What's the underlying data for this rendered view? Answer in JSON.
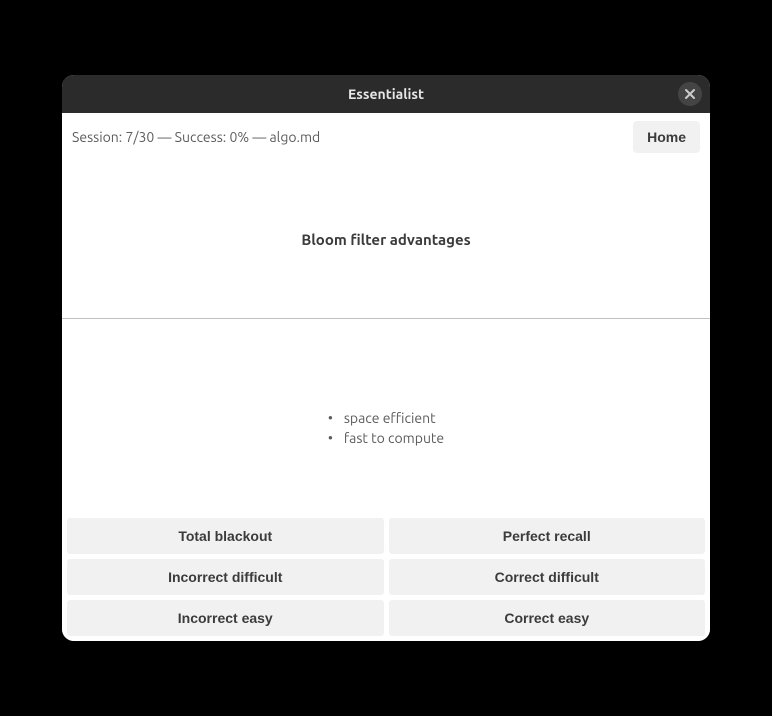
{
  "titlebar": {
    "title": "Essentialist"
  },
  "topbar": {
    "session_text": "Session: 7/30 — Success: 0% — algo.md",
    "home_label": "Home"
  },
  "card": {
    "question": "Bloom filter advantages",
    "answers": [
      "space efficient",
      "fast to compute"
    ]
  },
  "buttons": {
    "total_blackout": "Total blackout",
    "perfect_recall": "Perfect recall",
    "incorrect_difficult": "Incorrect difficult",
    "correct_difficult": "Correct difficult",
    "incorrect_easy": "Incorrect easy",
    "correct_easy": "Correct easy"
  }
}
